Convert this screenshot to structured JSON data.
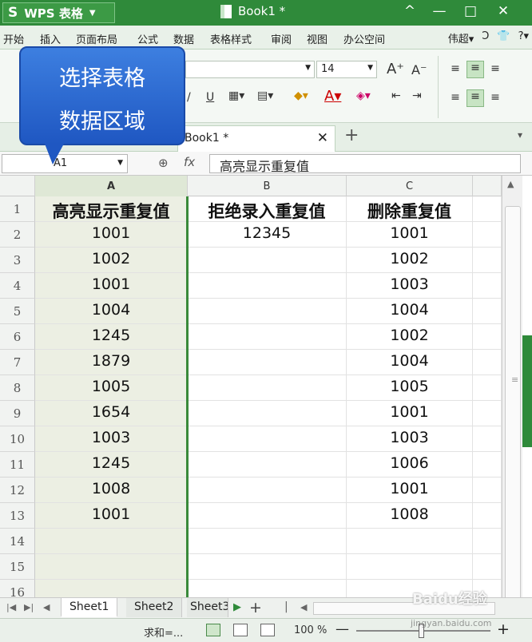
{
  "titlebar": {
    "app_name": "WPS 表格",
    "logo": "S",
    "doc_title": "Book1 *",
    "controls": [
      "^",
      "—",
      "□",
      "✕"
    ]
  },
  "menu": {
    "items": [
      "开始",
      "插入",
      "页面布局",
      "公式",
      "数据",
      "表格样式",
      "审阅",
      "视图",
      "办公空间"
    ],
    "right": [
      "伟超▾",
      "Ↄ",
      "👕",
      "?▾"
    ]
  },
  "ribbon": {
    "font_size": "14",
    "underline": "U",
    "grow_font": "A⁺",
    "shrink_font": "A⁻"
  },
  "callout": {
    "line1": "选择表格",
    "line2": "数据区域"
  },
  "tabs": {
    "doc_tab": "Book1 *",
    "close": "✕",
    "new": "+",
    "menu": "▾"
  },
  "formula_bar": {
    "namebox": "A1",
    "fx": "fx",
    "content": "高亮显示重复值"
  },
  "grid": {
    "columns": [
      "A",
      "B",
      "C"
    ],
    "rows": [
      "1",
      "2",
      "3",
      "4",
      "5",
      "6",
      "7",
      "8",
      "9",
      "10",
      "11",
      "12",
      "13",
      "14",
      "15",
      "16"
    ],
    "headers": [
      "高亮显示重复值",
      "拒绝录入重复值",
      "删除重复值"
    ],
    "colA": [
      "1001",
      "1002",
      "1001",
      "1004",
      "1245",
      "1879",
      "1005",
      "1654",
      "1003",
      "1245",
      "1008",
      "1001"
    ],
    "colB": [
      "12345"
    ],
    "colC": [
      "1001",
      "1002",
      "1003",
      "1004",
      "1002",
      "1004",
      "1005",
      "1001",
      "1003",
      "1006",
      "1001",
      "1008"
    ]
  },
  "sheets": {
    "tabs": [
      "Sheet1",
      "Sheet2",
      "Sheet3"
    ],
    "active": "Sheet1",
    "add": "+"
  },
  "status": {
    "sum": "求和=...",
    "zoom": "100 %"
  },
  "watermark": {
    "text": "Baidu经验",
    "sub": "jingyan.baidu.com"
  }
}
